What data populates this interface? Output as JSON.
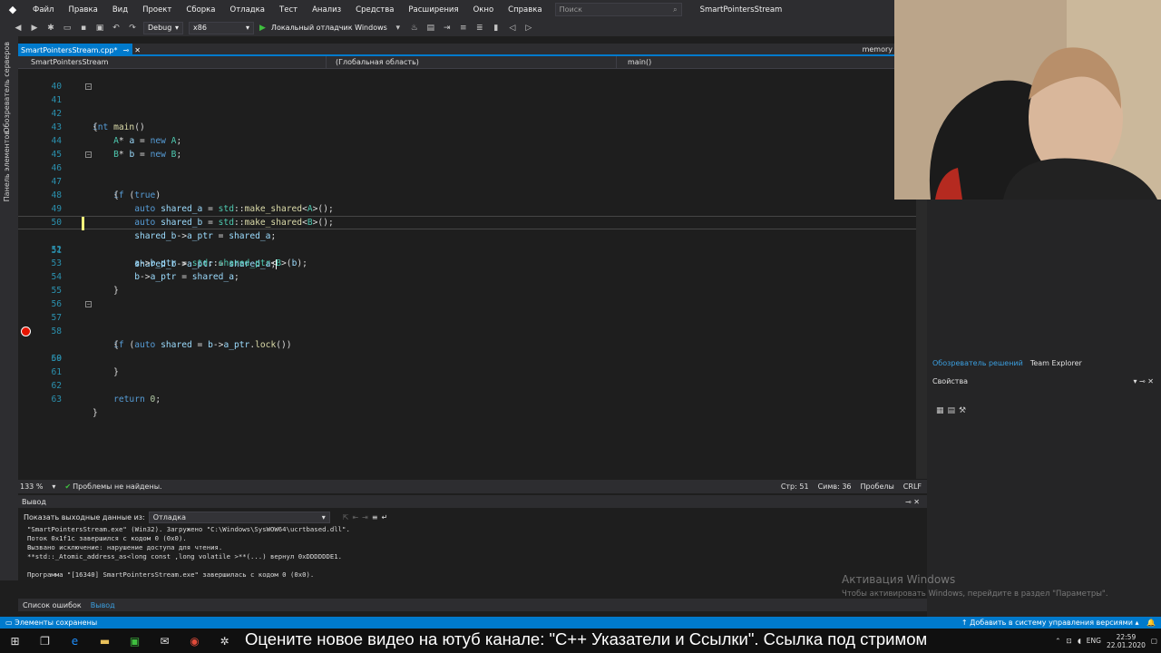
{
  "menubar": {
    "items": [
      "Файл",
      "Правка",
      "Вид",
      "Проект",
      "Сборка",
      "Отладка",
      "Тест",
      "Анализ",
      "Средства",
      "Расширения",
      "Окно",
      "Справка"
    ],
    "search_placeholder": "Поиск",
    "solution_title": "SmartPointersStream"
  },
  "toolbar": {
    "config": "Debug",
    "platform": "x86",
    "run_label": "Локальный отладчик Windows"
  },
  "left_strip": {
    "tab1": "Обозреватель серверов",
    "tab2": "Панель элементов"
  },
  "doc_tab": {
    "name": "SmartPointersStream.cpp*",
    "other": "memory"
  },
  "navbar": {
    "project": "SmartPointersStream",
    "scope": "(Глобальная область)",
    "member": "main()"
  },
  "code": {
    "lines": [
      {
        "n": "40",
        "t": ""
      },
      {
        "n": "41",
        "t": "int main()"
      },
      {
        "n": "42",
        "t": "{"
      },
      {
        "n": "43",
        "t": "    A* a = new A;"
      },
      {
        "n": "44",
        "t": "    B* b = new B;"
      },
      {
        "n": "45",
        "t": ""
      },
      {
        "n": "46",
        "t": "    if (true)"
      },
      {
        "n": "47",
        "t": "    {"
      },
      {
        "n": "48",
        "t": "        auto shared_a = std::make_shared<A>();"
      },
      {
        "n": "49",
        "t": "        auto shared_b = std::make_shared<B>();"
      },
      {
        "n": "50",
        "t": "        shared_b->a_ptr = shared_a;"
      },
      {
        "n": "51",
        "t": "        shared_b->a_ptr = shared_a;"
      },
      {
        "n": "52",
        "t": "        a->b_ptr = std::shared_ptr<B>(b);"
      },
      {
        "n": "53",
        "t": "        b->a_ptr = shared_a;"
      },
      {
        "n": "54",
        "t": "    }"
      },
      {
        "n": "55",
        "t": ""
      },
      {
        "n": "56",
        "t": ""
      },
      {
        "n": "57",
        "t": "    if (auto shared = b->a_ptr.lock())"
      },
      {
        "n": "58",
        "t": "    {"
      },
      {
        "n": "59",
        "t": ""
      },
      {
        "n": "60",
        "t": "    }"
      },
      {
        "n": "61",
        "t": ""
      },
      {
        "n": "62",
        "t": "    return 0;"
      },
      {
        "n": "63",
        "t": "}"
      }
    ]
  },
  "editor_status": {
    "zoom": "133 %",
    "issues": "Проблемы не найдены.",
    "line": "Стр: 51",
    "col": "Симв: 36",
    "ws": "Пробелы",
    "eol": "CRLF"
  },
  "output": {
    "title": "Вывод",
    "source_label": "Показать выходные данные из:",
    "source_value": "Отладка",
    "text": "\"SmartPointersStream.exe\" (Win32). Загружено \"C:\\Windows\\SysWOW64\\ucrtbased.dll\".\nПоток 0x1f1c завершился с кодом 0 (0x0).\nВызвано исключение: нарушение доступа для чтения.\n**std::_Atomic_address_as<long const ,long volatile >**(...) вернул 0xDDDDDDE1.\n\nПрограмма \"[16340] SmartPointersStream.exe\" завершилась с кодом 0 (0x0).",
    "tabs": [
      "Список ошибок",
      "Вывод"
    ]
  },
  "right_panel": {
    "tabs": [
      "Обозреватель решений",
      "Team Explorer"
    ],
    "props_title": "Свойства"
  },
  "watermark": {
    "title": "Активация Windows",
    "text": "Чтобы активировать Windows, перейдите в раздел \"Параметры\"."
  },
  "statusbar": {
    "left": "Элементы сохранены",
    "right": "Добавить в систему управления версиями"
  },
  "taskbar": {
    "ticker": "Оцените новое видео на ютуб канале: \"С++ Указатели и Ссылки\". Ссылка под стримом",
    "lang": "ENG",
    "time": "22:59",
    "date": "22.01.2020"
  },
  "colors": {
    "accent": "#007acc",
    "editor_bg": "#1e1e1e",
    "chrome_bg": "#2d2d30",
    "keyword": "#569cd6",
    "line_number": "#2b91af"
  }
}
